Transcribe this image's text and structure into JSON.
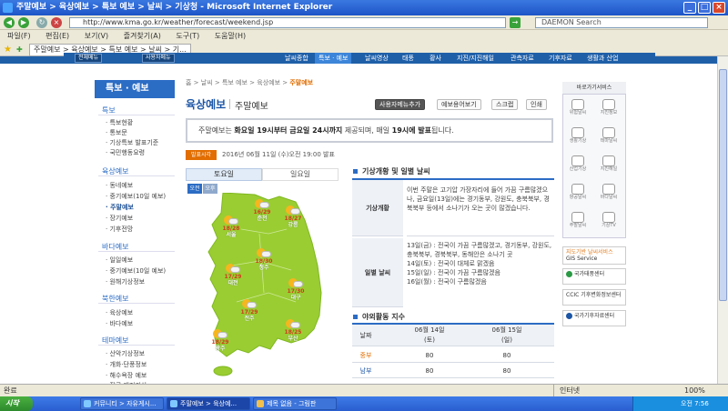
{
  "window": {
    "title": "주말예보 > 육상예보 > 특보 예보 > 날씨 > 기상청 - Microsoft Internet Explorer"
  },
  "addressbar": {
    "url": "http://www.kma.go.kr/weather/forecast/weekend.jsp",
    "search_placeholder": "DAEMON Search"
  },
  "menu": [
    "파일(F)",
    "편집(E)",
    "보기(V)",
    "즐겨찾기(A)",
    "도구(T)",
    "도움말(H)"
  ],
  "favtab": {
    "label": "주말예보 > 육상예보 > 특보 예보 > 날씨 > 기..."
  },
  "gnb": {
    "select1": "전체메뉴",
    "select2": "사용자메뉴",
    "items": [
      "날씨종합",
      "특보 · 예보",
      "날씨영상",
      "태풍",
      "황사",
      "지진/지진해일",
      "관측자료",
      "기후자료",
      "생활과 산업"
    ]
  },
  "lnb": {
    "title": "특보 · 예보",
    "sections": [
      {
        "label": "특보",
        "items": [
          "특보현황",
          "통보문",
          "기상특보 발표기준",
          "국민행동요령"
        ]
      },
      {
        "label": "육상예보",
        "items": [
          "동네예보",
          "중기예보(10일 예보)",
          "주말예보",
          "장기예보",
          "기후전망"
        ]
      },
      {
        "label": "바다예보",
        "items": [
          "일일예보",
          "중기예보(10일 예보)",
          "원해기상정보"
        ]
      },
      {
        "label": "북한예보",
        "items": [
          "육상예보",
          "바다예보"
        ]
      },
      {
        "label": "테마예보",
        "items": [
          "산악기상정보",
          "개화·단풍정보",
          "해수욕장 예보",
          "전국 레저기상"
        ]
      }
    ]
  },
  "breadcrumb": {
    "path": "홈 > 날씨 > 특보 예보 > 육상예보 > ",
    "current": "주말예보"
  },
  "page": {
    "title": "육상예보",
    "subtitle": "주말예보"
  },
  "toolbar": {
    "add_user_menu": "사용자메뉴추가",
    "rss": "예보용어보기",
    "scrap": "스크랩",
    "print": "인쇄"
  },
  "notice": {
    "p1": "주말예보는 ",
    "b1": "화요일 19시부터 금요일 24시까지",
    "p2": " 제공되며, 매일 ",
    "b2": "19시에 발표",
    "p3": "됩니다."
  },
  "issued": {
    "tag": "발표시각",
    "time": "2016년 06월 11일 (수)오전 19:00 발표"
  },
  "day_tabs": [
    "토요일",
    "일요일"
  ],
  "ampm": [
    "오전",
    "오후"
  ],
  "cities": [
    {
      "name": "춘천",
      "temp": "16/29"
    },
    {
      "name": "강릉",
      "temp": "18/27"
    },
    {
      "name": "서울",
      "temp": "18/28"
    },
    {
      "name": "청주",
      "temp": "18/30"
    },
    {
      "name": "대전",
      "temp": "17/29"
    },
    {
      "name": "대구",
      "temp": "17/30"
    },
    {
      "name": "전주",
      "temp": "17/29"
    },
    {
      "name": "부산",
      "temp": "18/25"
    },
    {
      "name": "광주",
      "temp": "18/29"
    }
  ],
  "overview": {
    "title": "기상개황 및 일별 날씨",
    "r1_label": "기상개황",
    "r1_text": "이번 주말은 고기압 가장자리에 들어 가끔 구름많겠으나, 금요일(13일)에는 경기동부, 강원도, 충북북부, 경북북부 등에서 소나기가 오는 곳이 많겠습니다.",
    "r2_label": "일별 날씨",
    "r2_lines": [
      "13일(금) : 전국이 가끔 구름많겠고, 경기동부, 강원도, 충북북부, 경북북부, 동해안은 소나기 곳",
      "14일(토) : 전국이 대체로 맑겠음",
      "15일(일) : 전국이 가끔 구름많겠음",
      "16일(월) : 전국이 구름많겠음"
    ]
  },
  "activity": {
    "title": "야외활동 지수",
    "header": [
      "날짜",
      "06월 14일",
      "(토)",
      "06월 15일",
      "(일)"
    ],
    "rows": [
      {
        "region": "중부",
        "d1": "80",
        "d2": "80"
      },
      {
        "region": "남부",
        "d1": "80",
        "d2": "80"
      }
    ]
  },
  "svc": {
    "title": "바로가기서비스",
    "icons": [
      "위험날씨",
      "지진정보",
      "생활기상",
      "테마날씨",
      "산업기상",
      "지진해일",
      "항공날씨",
      "바다날씨",
      "주말날씨",
      "기상TV"
    ]
  },
  "banners": [
    {
      "line1": "지도기반 날씨서비스",
      "line2": "GIS Service",
      "color": "#e07a1b"
    },
    {
      "line1": "국가태풍센터",
      "line2": "",
      "color": "#2b9a45"
    },
    {
      "line1": "CCIC 기후변화정보센터",
      "line2": "",
      "color": "#1b55a5"
    },
    {
      "line1": "국가기후자료센터",
      "line2": "",
      "color": "#1b55a5"
    }
  ],
  "status": {
    "left": "완료",
    "zone": "인터넷",
    "zoom": "100%"
  },
  "taskbar": {
    "start": "시작",
    "tasks": [
      "커뮤니티 > 자유게시...",
      "주말예보 > 육상예...",
      "제목 없음 - 그림판"
    ],
    "clock": "오전 7:56"
  }
}
